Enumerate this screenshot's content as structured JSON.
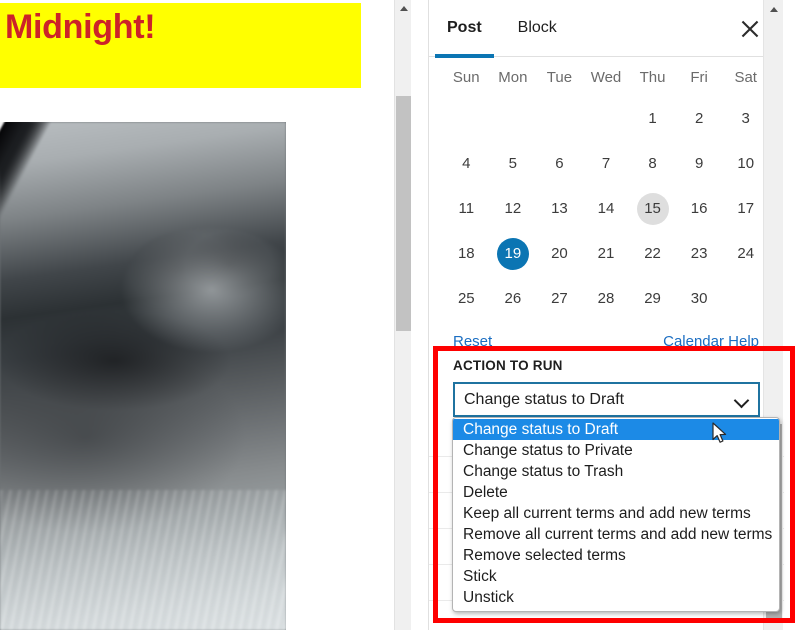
{
  "editor": {
    "heading_text": "Midnight!",
    "heading_bg": "#ffff00",
    "heading_color": "#cc2229",
    "image_alt": "blurred grayscale photograph"
  },
  "sidebar": {
    "tabs": [
      {
        "label": "Post",
        "active": true
      },
      {
        "label": "Block",
        "active": false
      }
    ],
    "close_label": "Close settings",
    "calendar": {
      "day_headers": [
        "Sun",
        "Mon",
        "Tue",
        "Wed",
        "Thu",
        "Fri",
        "Sat"
      ],
      "leading_blanks": 4,
      "days": [
        1,
        2,
        3,
        4,
        5,
        6,
        7,
        8,
        9,
        10,
        11,
        12,
        13,
        14,
        15,
        16,
        17,
        18,
        19,
        20,
        21,
        22,
        23,
        24,
        25,
        26,
        27,
        28,
        29,
        30
      ],
      "today": 15,
      "selected": 19,
      "selected_color": "#0b75b3",
      "today_color": "#dedede",
      "links": {
        "reset": "Reset",
        "help": "Calendar Help"
      }
    },
    "action": {
      "label": "ACTION TO RUN",
      "selected_value": "Change status to Draft",
      "select_border_color": "#1f73a0",
      "options": [
        "Change status to Draft",
        "Change status to Private",
        "Change status to Trash",
        "Delete",
        "Keep all current terms and add new terms",
        "Remove all current terms and add new terms",
        "Remove selected terms",
        "Stick",
        "Unstick"
      ],
      "highlighted_index": 0,
      "highlight_color": "#1c8ae6"
    }
  },
  "annotation": {
    "highlight_rect_color": "#fe0000"
  }
}
